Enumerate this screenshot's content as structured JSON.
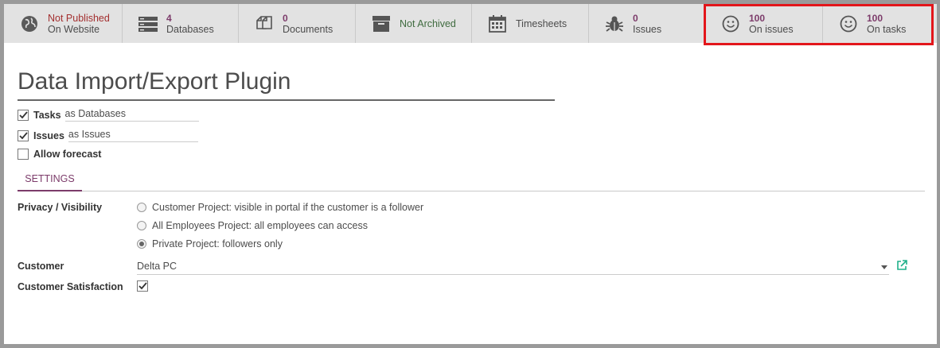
{
  "smart_buttons": {
    "website": {
      "value": "Not Published",
      "label": "On Website",
      "icon": "globe-icon"
    },
    "databases": {
      "value": "4",
      "label": "Databases",
      "icon": "server-icon"
    },
    "documents": {
      "value": "0",
      "label": "Documents",
      "icon": "files-icon"
    },
    "archive": {
      "label": "Not Archived",
      "icon": "archive-icon"
    },
    "timesheets": {
      "label": "Timesheets",
      "icon": "calendar-icon"
    },
    "issues": {
      "value": "0",
      "label": "Issues",
      "icon": "bug-icon"
    },
    "on_issues": {
      "value": "100",
      "label": "On issues",
      "icon": "smiley-icon"
    },
    "on_tasks": {
      "value": "100",
      "label": "On tasks",
      "icon": "smiley-icon"
    }
  },
  "form": {
    "title": "Data Import/Export Plugin",
    "tasks": {
      "label": "Tasks",
      "alias_prefix": "as",
      "alias": "Databases",
      "checked": true
    },
    "issues": {
      "label": "Issues",
      "alias_prefix": "as",
      "alias": "Issues",
      "checked": true
    },
    "forecast": {
      "label": "Allow forecast",
      "checked": false
    }
  },
  "tabs": {
    "settings": "SETTINGS"
  },
  "settings": {
    "privacy_label": "Privacy / Visibility",
    "privacy_options": [
      {
        "label": "Customer Project: visible in portal if the customer is a follower",
        "selected": false
      },
      {
        "label": "All Employees Project: all employees can access",
        "selected": false
      },
      {
        "label": "Private Project: followers only",
        "selected": true
      }
    ],
    "customer_label": "Customer",
    "customer_value": "Delta PC",
    "satisfaction_label": "Customer Satisfaction",
    "satisfaction_checked": true
  },
  "colors": {
    "accent": "#7c3b6a",
    "green": "#3f6b3f",
    "highlight": "#e3161b",
    "link": "#1fb08a"
  }
}
